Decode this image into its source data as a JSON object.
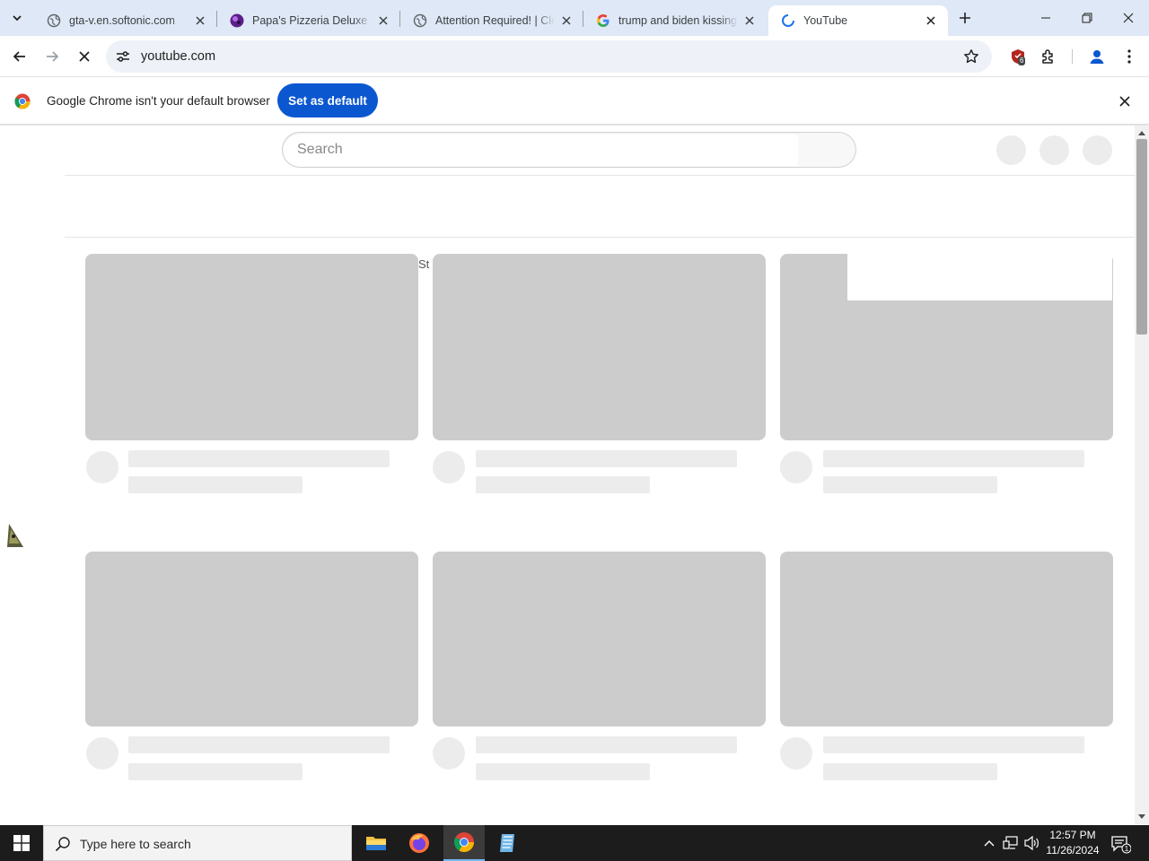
{
  "browser": {
    "tabs": [
      {
        "title": "gta-v.en.softonic.com",
        "favicon": "globe-icon"
      },
      {
        "title": "Papa's Pizzeria Deluxe Fr",
        "favicon": "purple-game-icon"
      },
      {
        "title": "Attention Required! | Clo",
        "favicon": "globe-icon"
      },
      {
        "title": "trump and biden kissing",
        "favicon": "google-icon"
      },
      {
        "title": "YouTube",
        "favicon": "loading-spinner-icon",
        "active": true
      }
    ],
    "address": "youtube.com",
    "extension_badge": "6"
  },
  "infobar": {
    "message": "Google Chrome isn't your default browser",
    "button_label": "Set as default"
  },
  "youtube": {
    "search_placeholder": "Search",
    "leaked_text": "St"
  },
  "taskbar": {
    "search_placeholder": "Type here to search",
    "time": "12:57 PM",
    "date": "11/26/2024",
    "notification_count": "1",
    "apps": [
      "file-explorer-icon",
      "firefox-icon",
      "chrome-icon",
      "notepad-app-icon"
    ]
  },
  "colors": {
    "tabstrip": "#dfe8f6",
    "accent_button": "#0b57d0",
    "skeleton_thumb": "#cccccc",
    "skeleton_text": "#ececec",
    "taskbar": "#1c1c1c"
  }
}
